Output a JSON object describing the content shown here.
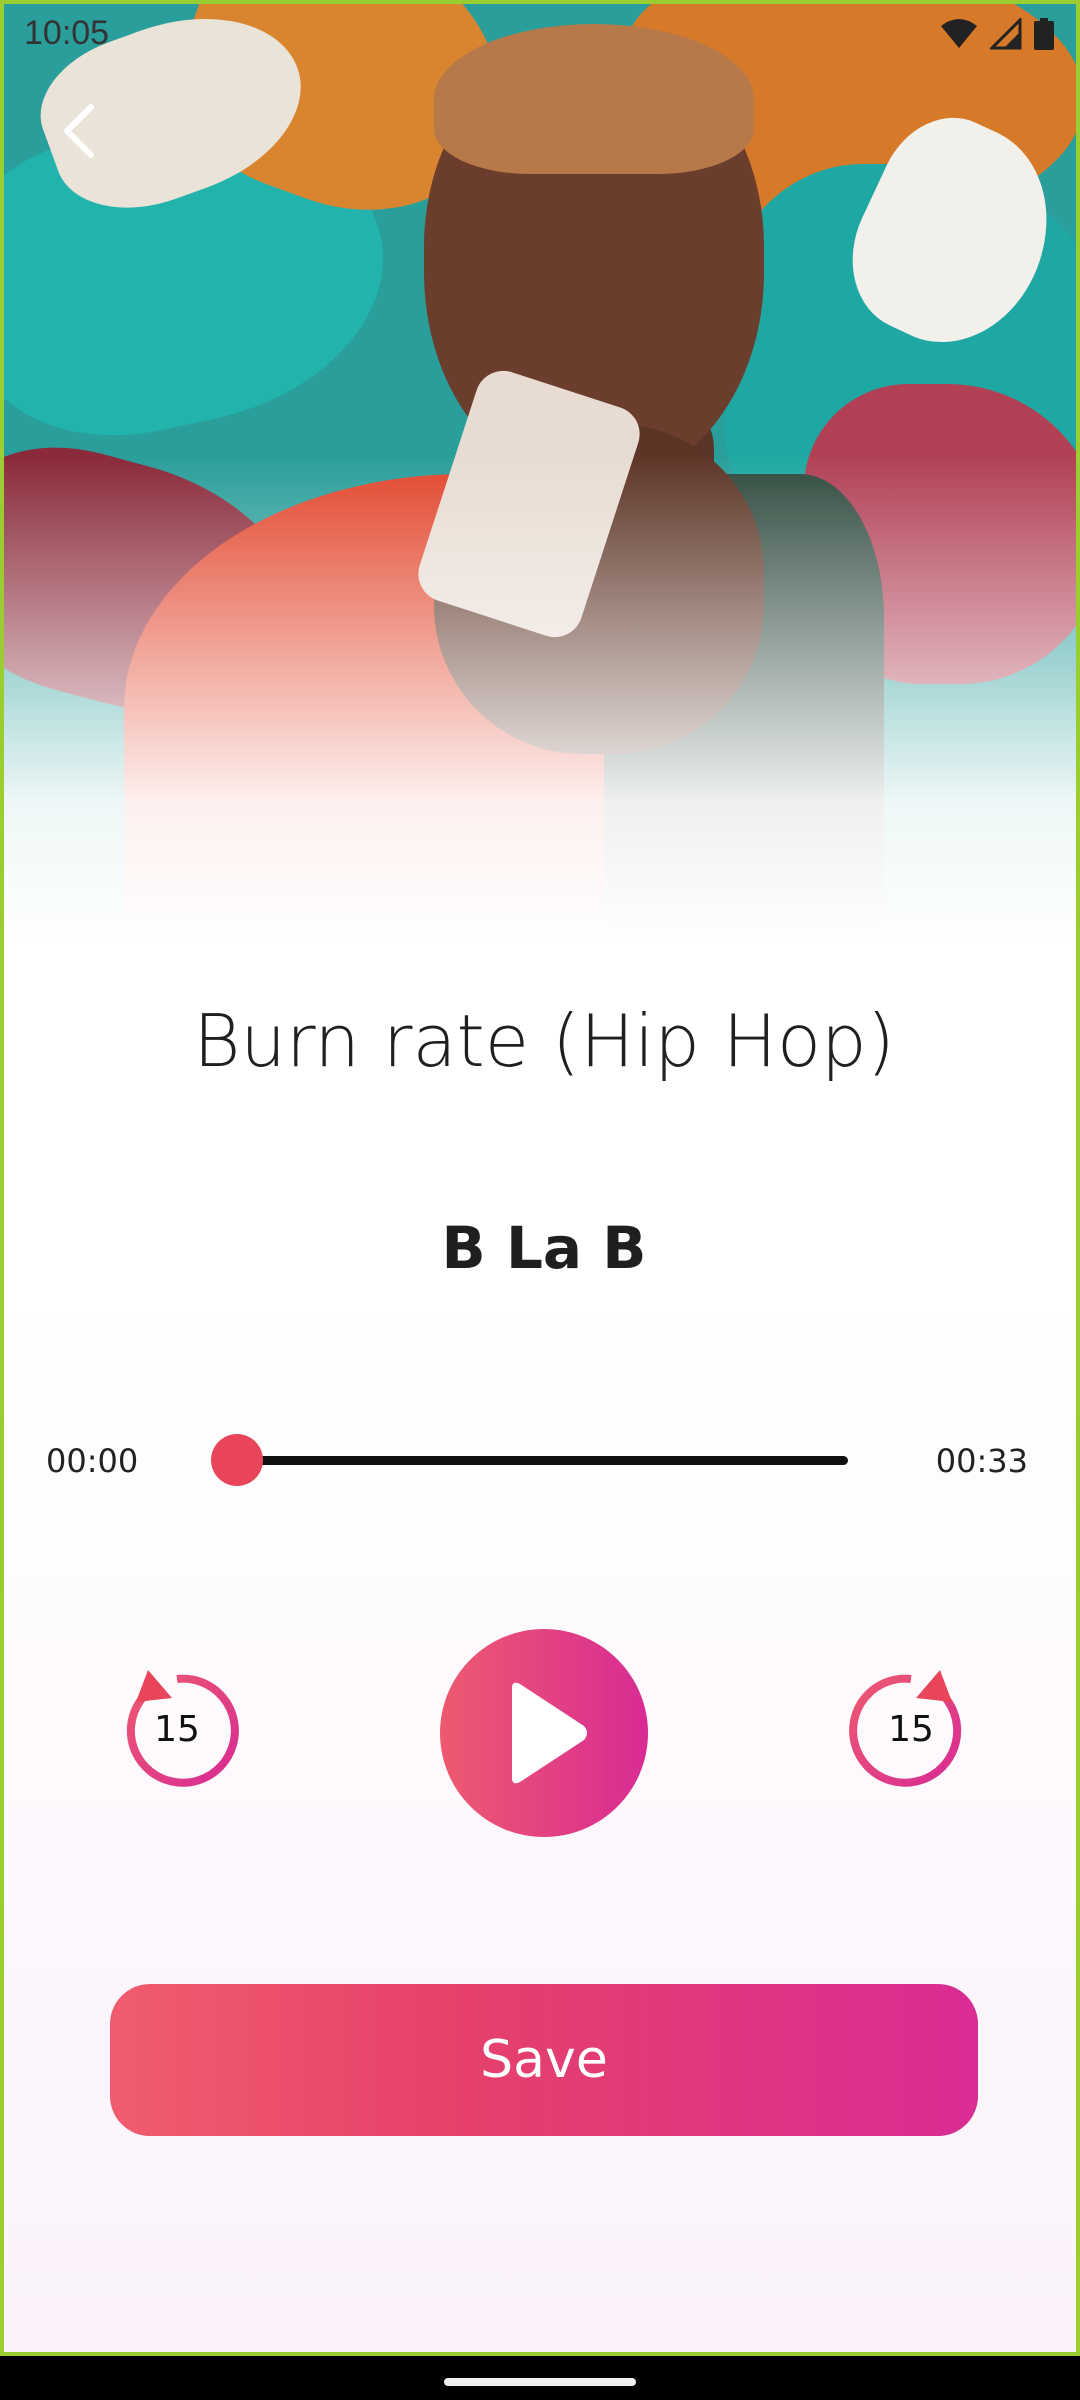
{
  "status_bar": {
    "time": "10:05",
    "icons": [
      "wifi-icon",
      "signal-icon",
      "battery-icon"
    ]
  },
  "header": {
    "back_icon": "chevron-left-icon"
  },
  "track": {
    "title": "Burn rate (Hip Hop)",
    "artist": "B La B"
  },
  "player": {
    "current_time": "00:00",
    "duration": "00:33",
    "progress": 0,
    "skip_back_seconds": "15",
    "skip_forward_seconds": "15",
    "play_icon": "play-icon"
  },
  "actions": {
    "save_label": "Save"
  },
  "colors": {
    "accent_start": "#ee5a6f",
    "accent_end": "#d82b94",
    "slider_thumb": "#e8455a"
  }
}
